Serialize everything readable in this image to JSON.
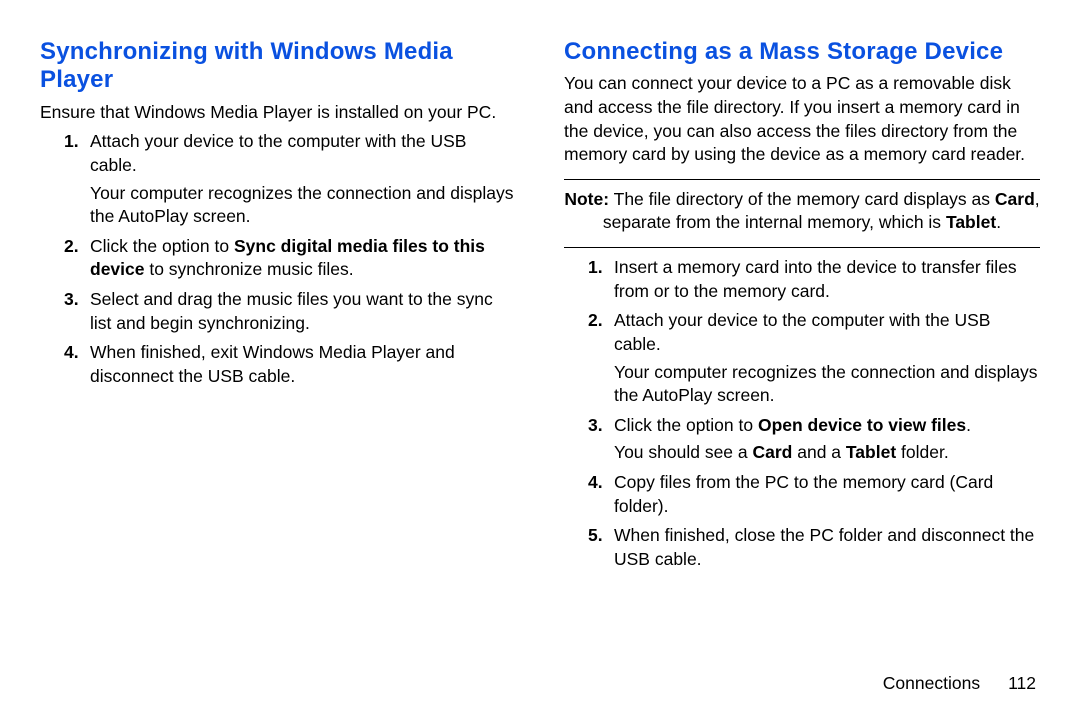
{
  "left": {
    "title": "Synchronizing with Windows Media Player",
    "intro": "Ensure that Windows Media Player is installed on your PC.",
    "steps": {
      "s1_a": "Attach your device to the computer with the USB cable.",
      "s1_b": "Your computer recognizes the connection and displays the AutoPlay screen.",
      "s2_a": "Click the option to ",
      "s2_bold": "Sync digital media files to this device",
      "s2_b": " to synchronize music files.",
      "s3": "Select and drag the music files you want to the sync list and begin synchronizing.",
      "s4": "When finished, exit Windows Media Player and disconnect the USB cable."
    }
  },
  "right": {
    "title": "Connecting as a Mass Storage Device",
    "intro": "You can connect your device to a PC as a removable disk and access the file directory. If you insert a memory card in the device, you can also access the files directory from the memory card by using the device as a memory card reader.",
    "note": {
      "label": "Note:",
      "a": " The file directory of the memory card displays as ",
      "card": "Card",
      "b": ", separate from the internal memory, which is ",
      "tablet": "Tablet",
      "c": "."
    },
    "steps": {
      "s1": "Insert a memory card into the device to transfer files from or to the memory card.",
      "s2_a": "Attach your device to the computer with the USB cable.",
      "s2_b": "Your computer recognizes the connection and displays the AutoPlay screen.",
      "s3_a": "Click the option to ",
      "s3_bold": "Open device to view files",
      "s3_b": ".",
      "s3_c_a": "You should see a ",
      "s3_card": "Card",
      "s3_c_b": " and a ",
      "s3_tablet": "Tablet",
      "s3_c_c": " folder.",
      "s4": "Copy files from the PC to the memory card (Card folder).",
      "s5": "When finished, close the PC folder and disconnect the USB cable."
    }
  },
  "footer": {
    "section": "Connections",
    "page": "112"
  }
}
